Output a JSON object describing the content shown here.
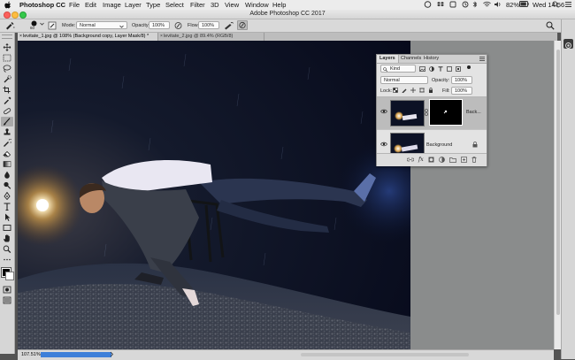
{
  "menubar": {
    "app": "Photoshop CC",
    "items": [
      "File",
      "Edit",
      "Image",
      "Layer",
      "Type",
      "Select",
      "Filter",
      "3D",
      "View",
      "Window",
      "Help"
    ],
    "battery": "82%",
    "time": "Wed 14:56"
  },
  "window": {
    "title": "Adobe Photoshop CC 2017"
  },
  "options": {
    "brush_size": "60",
    "mode_label": "Mode:",
    "mode_value": "Normal",
    "opacity_label": "Opacity:",
    "opacity_value": "100%",
    "flow_label": "Flow:",
    "flow_value": "100%"
  },
  "tabs": [
    {
      "label": "levitate_1.jpg @ 108% (Background copy, Layer Mask/8) *"
    },
    {
      "label": "levitate_2.jpg @ 89.4% (RGB/8)"
    }
  ],
  "status": {
    "zoom": "107.51%"
  },
  "layers_panel": {
    "tabs": [
      "Layers",
      "Channels",
      "History"
    ],
    "kind_label": "Kind",
    "blend_mode": "Normal",
    "opacity_label": "Opacity:",
    "opacity_value": "100%",
    "lock_label": "Lock:",
    "fill_label": "Fill:",
    "fill_value": "100%",
    "layers": [
      {
        "name": "Back..."
      },
      {
        "name": "Background"
      }
    ]
  },
  "colors": {
    "accent": "#3d7fd9",
    "panel": "#e3e3e3",
    "chrome": "#d6d6d6"
  }
}
